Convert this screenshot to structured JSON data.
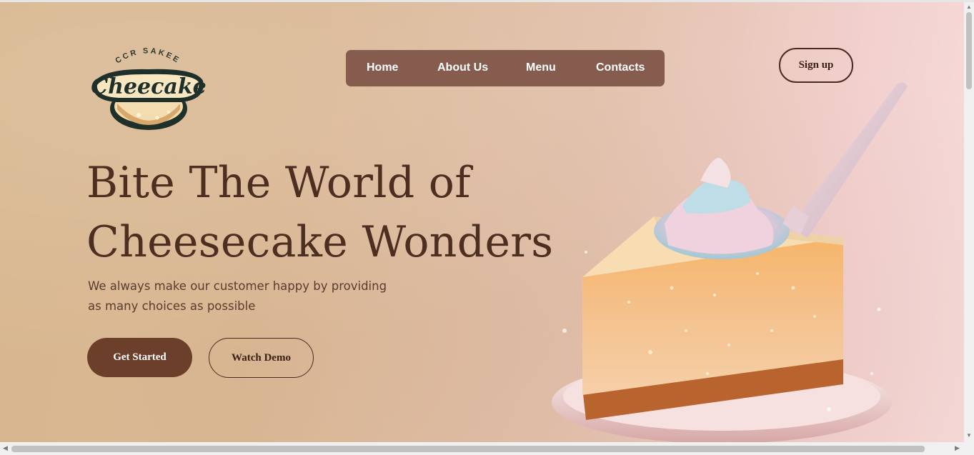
{
  "logo": {
    "arc_text": "CCR SAKEE",
    "wordmark": "Cheecake"
  },
  "nav": {
    "items": [
      "Home",
      "About Us",
      "Menu",
      "Contacts"
    ]
  },
  "signup_label": "Sign up",
  "hero": {
    "title_line1": "Bite The World of",
    "title_line2": "Cheesecake Wonders",
    "subtitle_line1": "We always make our customer happy by providing",
    "subtitle_line2": "as many choices as possible"
  },
  "buttons": {
    "primary": "Get Started",
    "secondary": "Watch Demo"
  },
  "colors": {
    "nav_bg": "#855c4e",
    "primary_btn": "#6b3f2a",
    "heading": "#4d2f22"
  }
}
